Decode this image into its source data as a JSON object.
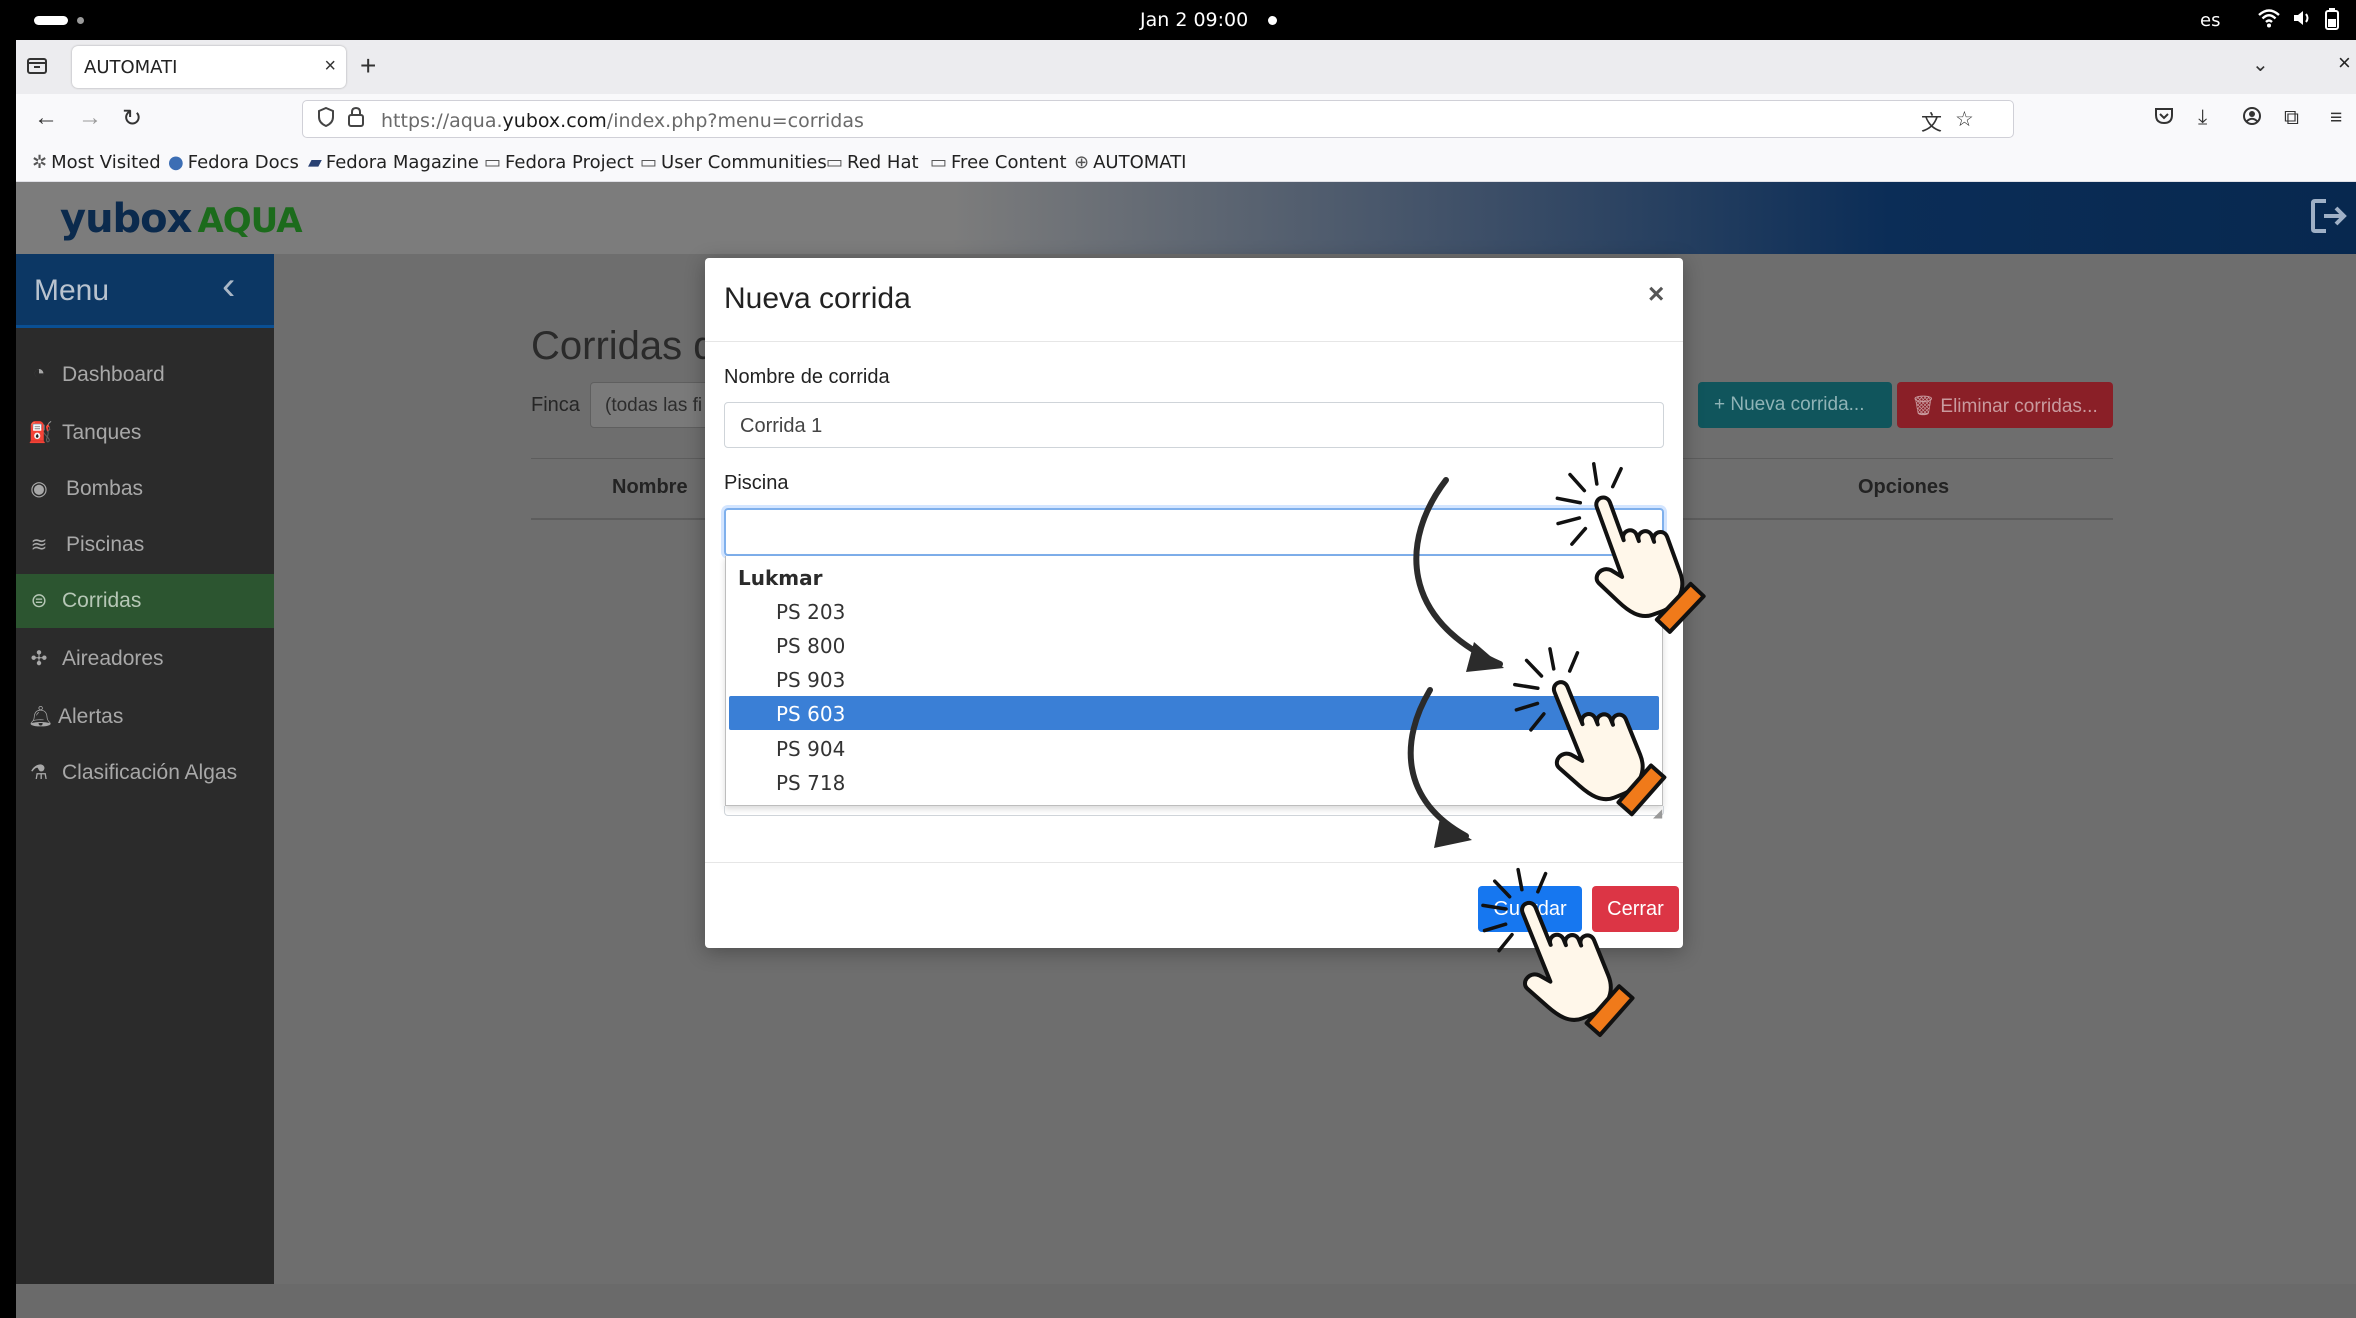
{
  "os": {
    "clock": "Jan 2  09:00",
    "lang": "es"
  },
  "browser": {
    "tab_title": "AUTOMATI",
    "url_prefix": "https://aqua.",
    "url_domain": "yubox.com",
    "url_path": "/index.php?menu=corridas",
    "bookmarks": [
      "Most Visited",
      "Fedora Docs",
      "Fedora Magazine",
      "Fedora Project",
      "User Communities",
      "Red Hat",
      "Free Content",
      "AUTOMATI"
    ]
  },
  "app": {
    "logo_main": "yubox",
    "logo_sub": "AQUA",
    "menu_title": "Menu",
    "sidebar": [
      {
        "label": "Dashboard",
        "icon": "dashboard-icon"
      },
      {
        "label": "Tanques",
        "icon": "gas-pump-icon"
      },
      {
        "label": "Bombas",
        "icon": "pump-icon"
      },
      {
        "label": "Piscinas",
        "icon": "water-waves-icon"
      },
      {
        "label": "Corridas",
        "icon": "shrimp-icon"
      },
      {
        "label": "Aireadores",
        "icon": "fan-icon"
      },
      {
        "label": "Alertas",
        "icon": "bell-icon"
      },
      {
        "label": "Clasificación Algas",
        "icon": "microscope-icon"
      }
    ],
    "active_item": "Corridas",
    "page_title": "Corridas d",
    "finca_label": "Finca",
    "finca_value": "(todas las fi",
    "btn_nueva": "+ Nueva corrida...",
    "btn_eliminar": "Eliminar corridas...",
    "table_headers": [
      "Nombre",
      "Opciones"
    ]
  },
  "modal": {
    "title": "Nueva corrida",
    "close": "×",
    "nombre_label": "Nombre de corrida",
    "nombre_value": "Corrida 1",
    "piscina_label": "Piscina",
    "piscina_value": "",
    "optgroup": "Lukmar",
    "options": [
      "PS 203",
      "PS 800",
      "PS 903",
      "PS 603",
      "PS 904",
      "PS 718"
    ],
    "selected_option": "PS 603",
    "btn_guardar": "Guardar",
    "btn_cerrar": "Cerrar"
  },
  "colors": {
    "primary": "#1677f0",
    "danger": "#dc3545",
    "selected": "#3a7fd6",
    "sidebar_active": "#2c5530",
    "hand_cuff": "#f07a1a"
  }
}
